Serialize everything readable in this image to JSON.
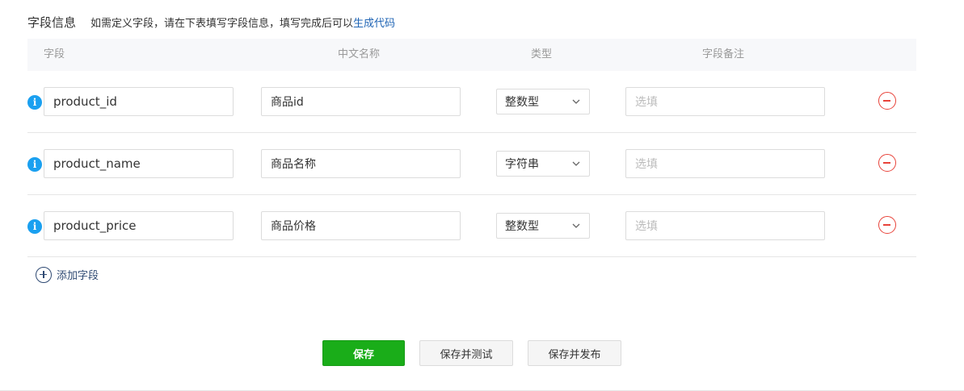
{
  "header": {
    "title": "字段信息",
    "description": "如需定义字段，请在下表填写字段信息，填写完成后可以",
    "generate_link": "生成代码"
  },
  "table": {
    "columns": [
      "字段",
      "中文名称",
      "类型",
      "字段备注"
    ],
    "rows": [
      {
        "field": "product_id",
        "cn_name": "商品id",
        "type": "整数型",
        "note_placeholder": "选填"
      },
      {
        "field": "product_name",
        "cn_name": "商品名称",
        "type": "字符串",
        "note_placeholder": "选填"
      },
      {
        "field": "product_price",
        "cn_name": "商品价格",
        "type": "整数型",
        "note_placeholder": "选填"
      }
    ]
  },
  "add_field_label": "添加字段",
  "buttons": {
    "save": "保存",
    "save_test": "保存并测试",
    "save_publish": "保存并发布"
  },
  "colors": {
    "primary_green": "#1aad19",
    "info_blue": "#1aa0f0",
    "link_blue": "#1f64b4",
    "remove_red": "#e8433a"
  },
  "icons": [
    "info-icon",
    "chevron-down-icon",
    "remove-circle-icon",
    "add-circle-icon"
  ]
}
